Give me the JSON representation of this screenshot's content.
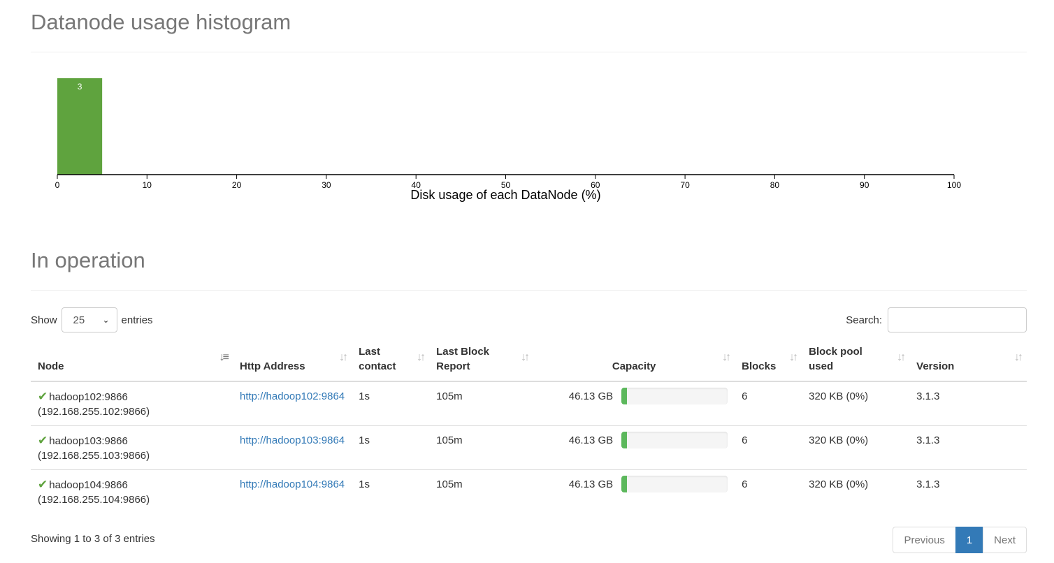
{
  "histogram": {
    "title": "Datanode usage histogram",
    "chart_data": {
      "type": "bar",
      "bins": [
        {
          "x0": 0,
          "x1": 5,
          "count": 3
        }
      ],
      "xticks": [
        0,
        10,
        20,
        30,
        40,
        50,
        60,
        70,
        80,
        90,
        100
      ],
      "xlabel": "Disk usage of each DataNode (%)",
      "xlim": [
        0,
        100
      ],
      "bar_color": "#5fa33e"
    }
  },
  "operation": {
    "title": "In operation",
    "show_label": "Show",
    "entries_label": "entries",
    "page_size": "25",
    "search_label": "Search:",
    "search_value": "",
    "columns": {
      "node": "Node",
      "http": "Http Address",
      "last_contact_1": "Last",
      "last_contact_2": "contact",
      "last_block_1": "Last Block",
      "last_block_2": "Report",
      "capacity": "Capacity",
      "blocks": "Blocks",
      "pool_1": "Block pool",
      "pool_2": "used",
      "version": "Version"
    },
    "rows": [
      {
        "node": "hadoop102:9866",
        "addr": "(192.168.255.102:9866)",
        "http": "http://hadoop102:9864",
        "last_contact": "1s",
        "last_block": "105m",
        "capacity": "46.13 GB",
        "used_fraction": 0.05,
        "blocks": "6",
        "pool": "320 KB (0%)",
        "version": "3.1.3"
      },
      {
        "node": "hadoop103:9866",
        "addr": "(192.168.255.103:9866)",
        "http": "http://hadoop103:9864",
        "last_contact": "1s",
        "last_block": "105m",
        "capacity": "46.13 GB",
        "used_fraction": 0.05,
        "blocks": "6",
        "pool": "320 KB (0%)",
        "version": "3.1.3"
      },
      {
        "node": "hadoop104:9866",
        "addr": "(192.168.255.104:9866)",
        "http": "http://hadoop104:9864",
        "last_contact": "1s",
        "last_block": "105m",
        "capacity": "46.13 GB",
        "used_fraction": 0.05,
        "blocks": "6",
        "pool": "320 KB (0%)",
        "version": "3.1.3"
      }
    ],
    "info": "Showing 1 to 3 of 3 entries",
    "pager": {
      "prev": "Previous",
      "current": "1",
      "next": "Next"
    }
  },
  "colors": {
    "accent": "#337ab7",
    "success": "#5cb85c"
  }
}
